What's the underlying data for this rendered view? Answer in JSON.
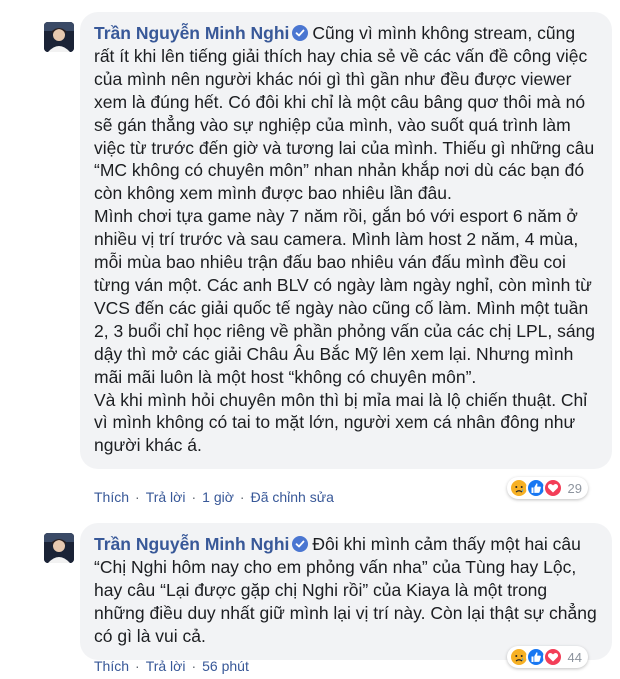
{
  "colors": {
    "bubble": "#f2f3f5",
    "author": "#385898",
    "verified": "#4a76d1",
    "like": "#1877f2",
    "love": "#f33e58",
    "sad": "#f7b125"
  },
  "comments": [
    {
      "author": "Trần Nguyễn Minh Nghi",
      "text": "Cũng vì mình không stream, cũng rất ít khi lên tiếng giải thích hay chia sẻ về các vấn đề công việc của mình nên người khác nói gì thì gần như đều được viewer xem là đúng hết. Có đôi khi chỉ là một câu bâng quơ thôi mà nó sẽ gán thẳng vào sự nghiệp của mình, vào suốt quá trình làm việc từ trước đến giờ và tương lai của mình. Thiếu gì những câu “MC không có chuyên môn” nhan nhản khắp nơi dù các bạn đó còn không xem mình được bao nhiêu lần đâu.\nMình chơi tựa game này 7 năm rồi, gắn bó với esport 6 năm ở nhiều vị trí trước và sau camera. Mình làm host 2 năm, 4 mùa, mỗi mùa bao nhiêu trận đấu bao nhiêu ván đấu mình đều coi từng ván một. Các anh BLV có ngày làm ngày nghỉ, còn mình từ VCS đến các giải quốc tế ngày nào cũng cố làm. Mình một tuần 2, 3 buổi chỉ học riêng về phần phỏng vấn của các chị LPL, sáng dậy thì mở các giải Châu Âu Bắc Mỹ lên xem lại. Nhưng mình mãi mãi luôn là một host “không có chuyên môn”.\nVà khi mình hỏi chuyên môn thì bị mỉa mai là lộ chiến thuật. Chỉ vì mình không có tai to mặt lớn, người xem cá nhân đông như người khác á.",
      "actions": {
        "like": "Thích",
        "reply": "Trả lời",
        "time": "1 giờ",
        "edited": "Đã chỉnh sửa"
      },
      "reactions": [
        "sad",
        "like",
        "love"
      ],
      "reaction_count": "29"
    },
    {
      "author": "Trần Nguyễn Minh Nghi",
      "text": "Đôi khi mình cảm thấy một hai câu “Chị Nghi hôm nay cho em phỏng vấn nha” của Tùng hay Lộc, hay câu “Lại được gặp chị Nghi rồi” của Kiaya là một trong những điều duy nhất giữ mình lại vị trí này. Còn lại thật sự chẳng có gì là vui cả.",
      "actions": {
        "like": "Thích",
        "reply": "Trả lời",
        "time": "56 phút"
      },
      "reactions": [
        "sad",
        "like",
        "love"
      ],
      "reaction_count": "44"
    }
  ]
}
